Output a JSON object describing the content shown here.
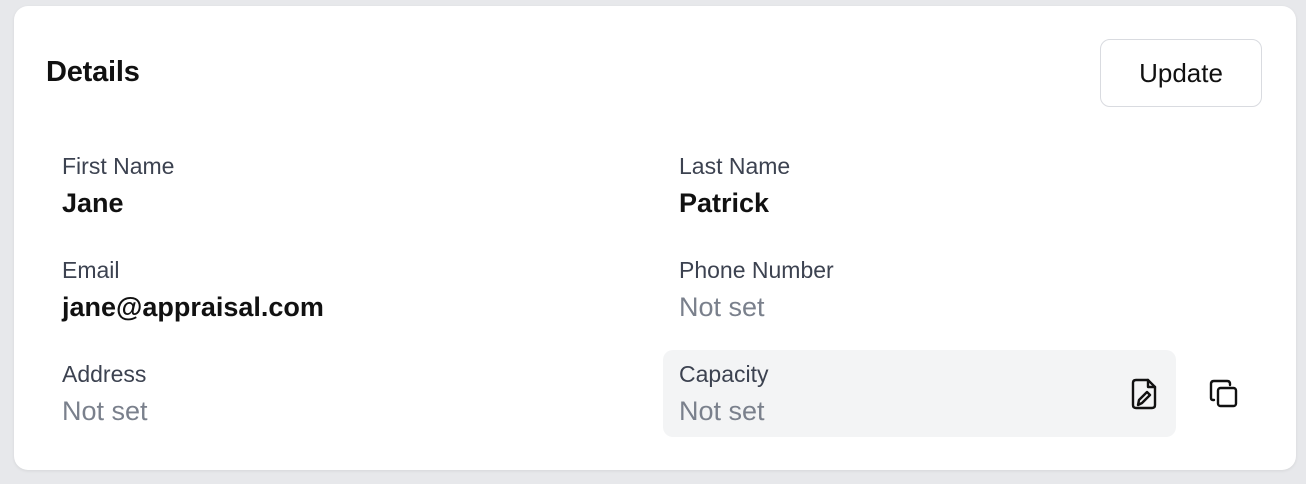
{
  "card": {
    "title": "Details",
    "update_label": "Update"
  },
  "fields": {
    "first_name": {
      "label": "First Name",
      "value": "Jane"
    },
    "last_name": {
      "label": "Last Name",
      "value": "Patrick"
    },
    "email": {
      "label": "Email",
      "value": "jane@appraisal.com"
    },
    "phone": {
      "label": "Phone Number",
      "value": "Not set"
    },
    "address": {
      "label": "Address",
      "value": "Not set"
    },
    "capacity": {
      "label": "Capacity",
      "value": "Not set"
    }
  },
  "icons": {
    "edit": "edit-icon",
    "copy": "copy-icon"
  }
}
